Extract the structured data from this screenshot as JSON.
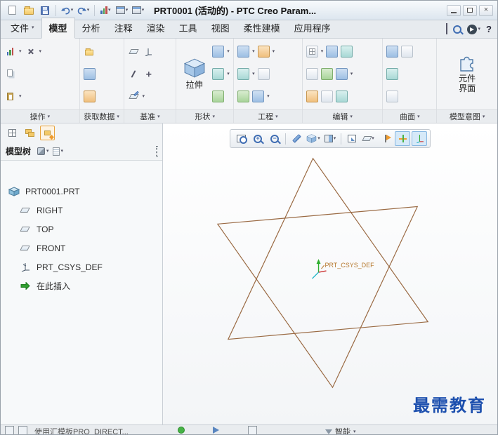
{
  "titlebar": {
    "title": "PRT0001 (活动的) - PTC Creo Param..."
  },
  "icons": {
    "caret": "▾",
    "plus": "+",
    "minus": "−",
    "close": "×",
    "help": "?"
  },
  "tabs": [
    {
      "label": "文件"
    },
    {
      "label": "模型"
    },
    {
      "label": "分析"
    },
    {
      "label": "注释"
    },
    {
      "label": "渲染"
    },
    {
      "label": "工具"
    },
    {
      "label": "视图"
    },
    {
      "label": "柔性建模"
    },
    {
      "label": "应用程序"
    }
  ],
  "ribbon": {
    "group_labels": [
      "操作",
      "获取数据",
      "基准",
      "形状",
      "工程",
      "编辑",
      "曲面",
      "模型意图"
    ],
    "extrude_label": "拉伸",
    "component_interface_label": "元件界面"
  },
  "tree_panel": {
    "title": "模型树",
    "items": [
      {
        "label": "PRT0001.PRT"
      },
      {
        "label": "RIGHT"
      },
      {
        "label": "TOP"
      },
      {
        "label": "FRONT"
      },
      {
        "label": "PRT_CSYS_DEF"
      },
      {
        "label": "在此插入"
      }
    ]
  },
  "canvas": {
    "csys_label": "PRT_CSYS_DEF",
    "watermark": "最需教育"
  },
  "statusbar": {
    "message": "使用汇模板PRO_DIRECT...",
    "filter_label": "智能"
  },
  "colors": {
    "star_line": "#9a6a43",
    "watermark_blue": "#1c4fae",
    "csys_label_orange": "#b5762a",
    "csys_green": "#2faf2f",
    "csys_red": "#cc3333",
    "csys_cyan": "#2ab8c8"
  }
}
